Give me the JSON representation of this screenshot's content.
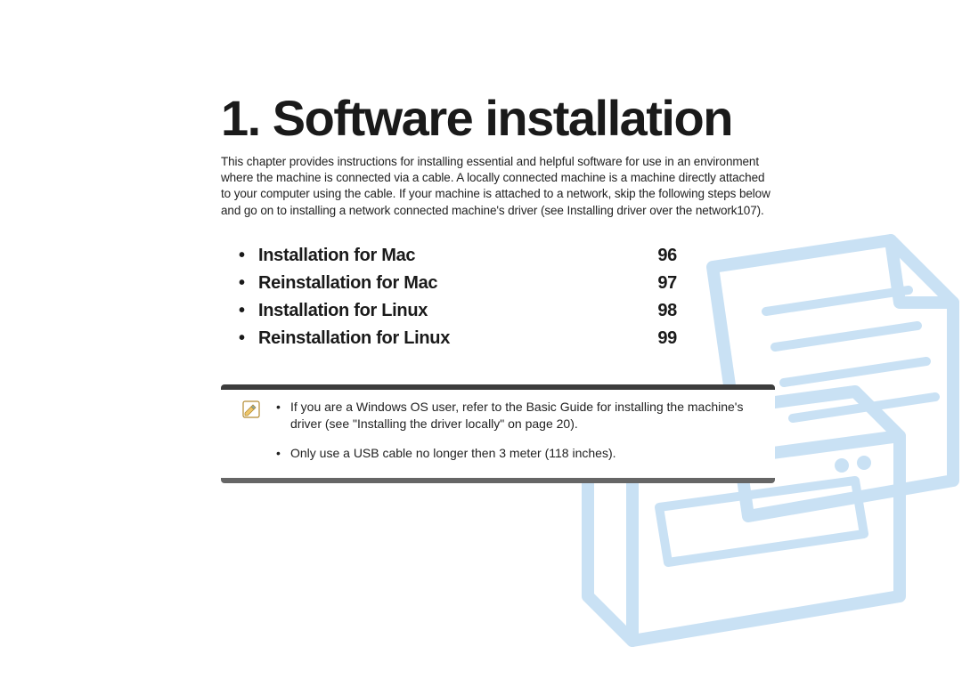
{
  "chapter": {
    "number": "1.",
    "title": "Software installation",
    "intro": "This chapter provides instructions for installing essential and helpful software for use in an environment where the machine is connected via a cable. A locally connected machine is a machine directly attached to your computer using the cable. If your machine is attached to a network, skip the following steps below and go on to installing a network connected machine's driver (see Installing driver over the network107)."
  },
  "toc": [
    {
      "label": "Installation for Mac",
      "page": "96"
    },
    {
      "label": "Reinstallation for Mac",
      "page": "97"
    },
    {
      "label": "Installation for Linux",
      "page": "98"
    },
    {
      "label": "Reinstallation for Linux",
      "page": "99"
    }
  ],
  "notes": [
    "If you are a Windows OS user, refer to the Basic Guide for installing the machine's driver (see \"Installing the driver locally\" on page 20).",
    "Only use a USB cable no longer then 3 meter (118 inches)."
  ]
}
